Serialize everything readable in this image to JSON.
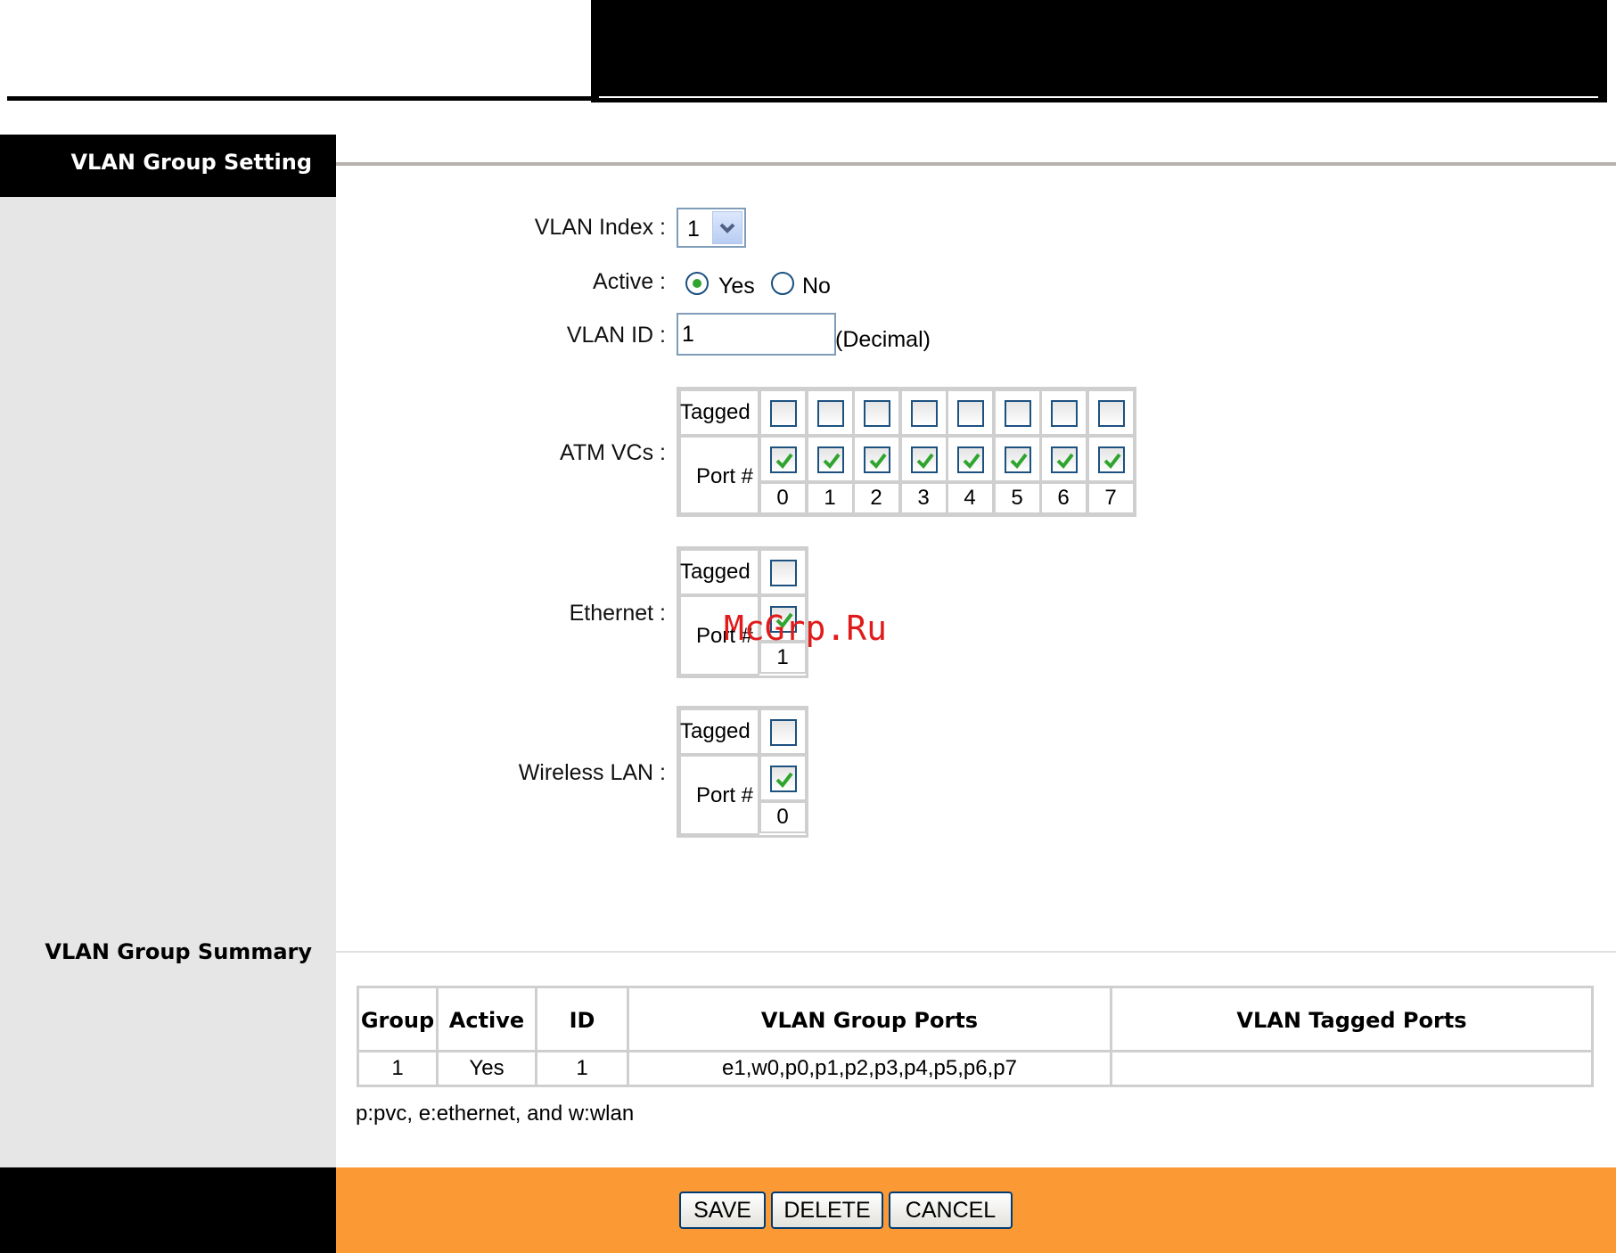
{
  "section_setting": {
    "title": "VLAN Group Setting"
  },
  "form": {
    "vlan_index": {
      "label": "VLAN Index :",
      "value": "1"
    },
    "active": {
      "label": "Active :",
      "options": [
        "Yes",
        "No"
      ],
      "selected": "Yes"
    },
    "vlan_id": {
      "label": "VLAN ID :",
      "value": "1",
      "hint": "(Decimal)"
    }
  },
  "port_groups": {
    "atm": {
      "label": "ATM VCs :",
      "tagged_label": "Tagged",
      "port_label": "Port #",
      "ports": [
        "0",
        "1",
        "2",
        "3",
        "4",
        "5",
        "6",
        "7"
      ],
      "tagged": [
        false,
        false,
        false,
        false,
        false,
        false,
        false,
        false
      ],
      "members": [
        true,
        true,
        true,
        true,
        true,
        true,
        true,
        true
      ]
    },
    "ethernet": {
      "label": "Ethernet :",
      "tagged_label": "Tagged",
      "port_label": "Port #",
      "ports": [
        "1"
      ],
      "tagged": [
        false
      ],
      "members": [
        true
      ]
    },
    "wlan": {
      "label": "Wireless LAN :",
      "tagged_label": "Tagged",
      "port_label": "Port #",
      "ports": [
        "0"
      ],
      "tagged": [
        false
      ],
      "members": [
        true
      ]
    }
  },
  "section_summary": {
    "title": "VLAN Group Summary"
  },
  "summary_table": {
    "headers": [
      "Group",
      "Active",
      "ID",
      "VLAN Group Ports",
      "VLAN Tagged Ports"
    ],
    "rows": [
      [
        "1",
        "Yes",
        "1",
        "e1,w0,p0,p1,p2,p3,p4,p5,p6,p7",
        ""
      ]
    ]
  },
  "legend": "p:pvc, e:ethernet, and w:wlan",
  "buttons": {
    "save": "SAVE",
    "delete": "DELETE",
    "cancel": "CANCEL"
  },
  "watermark": "McGrp.Ru",
  "colors": {
    "footer_orange": "#fb9a35",
    "left_panel_gray": "#e6e6e6",
    "check_green": "#2fa52f"
  }
}
